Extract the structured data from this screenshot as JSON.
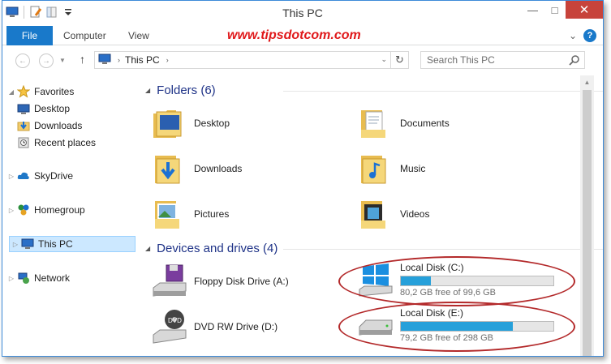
{
  "window": {
    "title": "This PC",
    "buttons": {
      "minimize": "—",
      "maximize": "□",
      "close": "✕"
    }
  },
  "ribbon": {
    "tabs": [
      "File",
      "Computer",
      "View"
    ],
    "watermark": "www.tipsdotcom.com",
    "expand_glyph": "⌄",
    "help": "?"
  },
  "address_bar": {
    "back": "←",
    "forward": "→",
    "up": "↑",
    "chevron": "›",
    "path": "This PC",
    "dropdown": "⌄",
    "refresh": "↻",
    "search_placeholder": "Search This PC"
  },
  "nav_pane": {
    "favorites": {
      "label": "Favorites",
      "children": [
        "Desktop",
        "Downloads",
        "Recent places"
      ]
    },
    "skydrive": "SkyDrive",
    "homegroup": "Homegroup",
    "this_pc": "This PC",
    "network": "Network",
    "expand_glyph": "▷",
    "collapse_glyph": "◢"
  },
  "content": {
    "folders_header": "Folders (6)",
    "folders": [
      "Desktop",
      "Documents",
      "Downloads",
      "Music",
      "Pictures",
      "Videos"
    ],
    "devices_header": "Devices and drives (4)",
    "devices": [
      {
        "name": "Floppy Disk Drive (A:)"
      },
      {
        "name": "Local Disk (C:)",
        "free_text": "80,2 GB free of 99,6 GB",
        "used_fraction": 0.195
      },
      {
        "name": "DVD RW Drive (D:)"
      },
      {
        "name": "Local Disk (E:)",
        "free_text": "79,2 GB free of 298 GB",
        "used_fraction": 0.734
      }
    ]
  },
  "colors": {
    "accent": "#1979ca",
    "bar_fill": "#26a0da",
    "annotation": "#b3292a",
    "watermark": "#e0191b",
    "group_header": "#1e3287"
  }
}
